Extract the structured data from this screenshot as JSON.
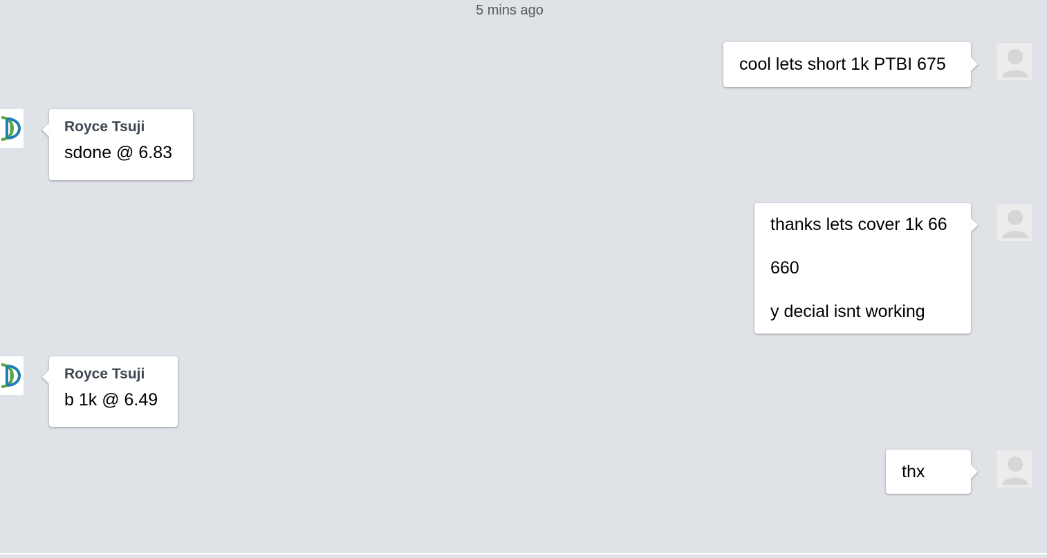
{
  "timestamp": "5 mins ago",
  "messages": [
    {
      "lines": [
        "cool lets short 1k PTBI 675"
      ]
    },
    {
      "sender": "Royce Tsuji",
      "lines": [
        "sdone @ 6.83"
      ]
    },
    {
      "lines": [
        "thanks lets cover 1k 66",
        "660",
        "y decial isnt working"
      ]
    },
    {
      "sender": "Royce Tsuji",
      "lines": [
        "b 1k @ 6.49"
      ]
    },
    {
      "lines": [
        "thx"
      ]
    }
  ],
  "colors": {
    "background": "#dfe3e7",
    "bubble": "#ffffff",
    "sender_name": "#3d4650",
    "timestamp": "#545a60",
    "logo_blue": "#1f7fb3",
    "logo_green": "#5aa544"
  },
  "icons": {
    "my_avatar": "default-user-silhouette-icon",
    "other_avatar": "company-logo-icon"
  }
}
